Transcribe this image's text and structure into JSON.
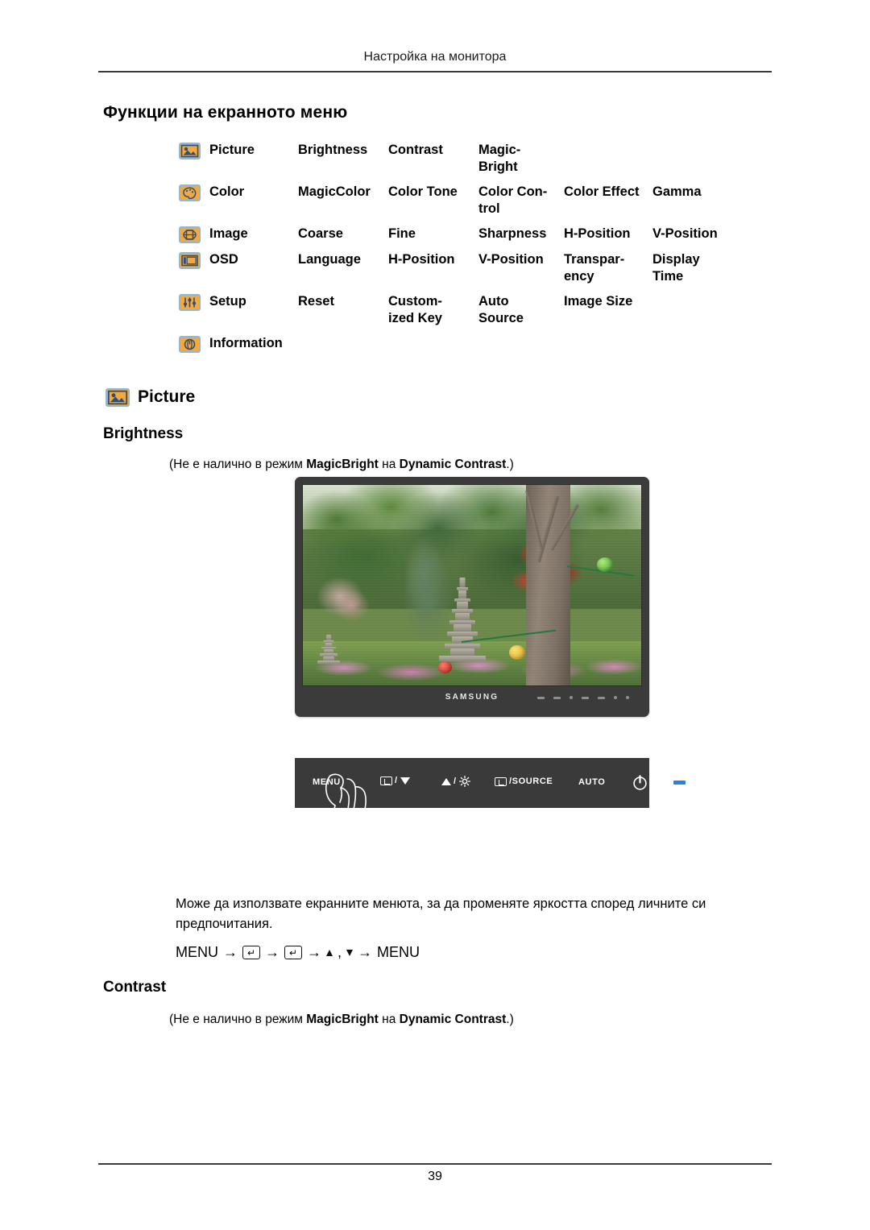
{
  "header": {
    "running_title": "Настройка на монитора"
  },
  "section": {
    "title": "Функции на екранното меню"
  },
  "osd_map": {
    "rows": [
      {
        "icon": "picture-icon",
        "category": "Picture",
        "items": [
          "Brightness",
          "Contrast",
          "Magic-\nBright",
          "",
          ""
        ]
      },
      {
        "icon": "color-palette-icon",
        "category": "Color",
        "items": [
          "MagicColor",
          "Color Tone",
          "Color  Con-\ntrol",
          "Color Effect",
          "Gamma"
        ]
      },
      {
        "icon": "image-icon",
        "category": "Image",
        "items": [
          "Coarse",
          "Fine",
          "Sharpness",
          "H-Position",
          "V-Position"
        ]
      },
      {
        "icon": "osd-icon",
        "category": "OSD",
        "items": [
          "Language",
          "H-Position",
          "V-Position",
          "Transpar-\nency",
          "Display\nTime"
        ]
      },
      {
        "icon": "setup-sliders-icon",
        "category": "Setup",
        "items": [
          "Reset",
          "Custom-\nized Key",
          "Auto\nSource",
          "Image Size",
          ""
        ]
      },
      {
        "icon": "information-clock-icon",
        "category": "Information",
        "items": [
          "",
          "",
          "",
          "",
          ""
        ]
      }
    ]
  },
  "picture_section": {
    "icon": "picture-icon",
    "title": "Picture",
    "brightness": {
      "title": "Brightness",
      "note_prefix": "(Не е налично в режим ",
      "note_bold1": "MagicBright",
      "note_mid": " на ",
      "note_bold2": "Dynamic Contrast",
      "note_suffix": ".)",
      "description": "Може да използвате екранните менюта, за да променяте яркостта според личните си предпочитания.",
      "sequence": {
        "start": "MENU",
        "arrow": "→",
        "key_glyph": "↵",
        "comma": ",",
        "end": "MENU"
      }
    },
    "contrast": {
      "title": "Contrast",
      "note_prefix": "(Не е налично в режим ",
      "note_bold1": "MagicBright",
      "note_mid": " на ",
      "note_bold2": "Dynamic Contrast",
      "note_suffix": ".)"
    }
  },
  "monitor_illustration": {
    "brand": "SAMSUNG",
    "screen_subject": "garden scene with stone pagodas, trees and paper lanterns"
  },
  "control_panel": {
    "buttons": [
      {
        "name": "menu-button",
        "label": "MENU"
      },
      {
        "name": "down-button",
        "label": "/"
      },
      {
        "name": "up-button",
        "label": "/"
      },
      {
        "name": "source-button",
        "label": "/SOURCE"
      },
      {
        "name": "auto-button",
        "label": "AUTO"
      },
      {
        "name": "power-button",
        "label": ""
      },
      {
        "name": "power-led",
        "label": ""
      }
    ]
  },
  "footer": {
    "page_number": "39"
  },
  "colors": {
    "icon_fill": "#f5a93c",
    "icon_border": "#8fb8d8",
    "icon_glyph": "#2b4f7a",
    "bezel": "#3a3a3a",
    "led": "#2e7fe0",
    "rule": "#3a3a3a"
  }
}
